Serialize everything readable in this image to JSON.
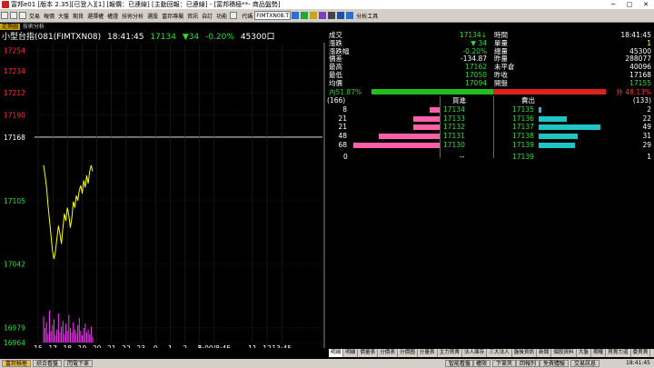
{
  "titlebar": {
    "title": "富邦e01 [版本 2.35][已登入][1] [報價：已連線] [主動回報：已連線] - [富邦積極**- 商品盤勢]",
    "minimize": "─",
    "maximize": "□",
    "close": "✕"
  },
  "menubar": {
    "items": [
      "交易",
      "報價",
      "大盤",
      "期貨",
      "選擇權",
      "權證",
      "技術分析",
      "選股",
      "富邦專屬",
      "資訊",
      "自訂",
      "功能"
    ],
    "search_label": "代碼",
    "search_value": "FIMTXN08.T",
    "analysis_tools": "分析工具"
  },
  "chart": {
    "tab_active": "走勢圖",
    "tab_other": "技術分析",
    "header": {
      "name": "小型台指(081(FIMTXN08)",
      "time": "18:41:45",
      "price": "17134",
      "change": "▼34",
      "pct": "-0.20%",
      "volume": "45300",
      "vol_mark": "口"
    },
    "y_ticks": [
      "17254",
      "17234",
      "17212",
      "17190",
      "17168",
      "17105",
      "17042",
      "16979",
      "16964"
    ],
    "x_ticks": [
      "15",
      "17",
      "18",
      "19",
      "20",
      "21",
      "22",
      "23",
      "0",
      "1",
      "2",
      "3",
      "5:00/8:45",
      "11",
      "12",
      "13:45"
    ]
  },
  "chart_data": {
    "type": "line",
    "series": [
      {
        "name": "",
        "values": [
          17140,
          17130,
          17118,
          17100,
          17085,
          17070,
          17055,
          17047,
          17055,
          17068,
          17080,
          17072,
          17062,
          17078,
          17092,
          17085,
          17098,
          17090,
          17078,
          17088,
          17104,
          17098,
          17110,
          17105,
          17115,
          17120,
          17112,
          17125,
          17118,
          17130,
          17122,
          17134,
          17140,
          17134
        ]
      }
    ],
    "ylim": [
      16964,
      17260
    ],
    "prev_close": 17168
  },
  "quote": {
    "rows": [
      {
        "l1": "成交",
        "v1": "17134↓",
        "c1": "#33dd33",
        "l2": "時間",
        "v2": "18:41:45",
        "c2": "#ffffff"
      },
      {
        "l1": "漲跌",
        "v1": "▼ 34",
        "c1": "#33dd33",
        "l2": "單量",
        "v2": "1",
        "c2": "#ffff33"
      },
      {
        "l1": "漲跌幅",
        "v1": "-0.20%",
        "c1": "#33dd33",
        "l2": "總量",
        "v2": "45300",
        "c2": "#ffffff"
      },
      {
        "l1": "價差",
        "v1": "-134.87",
        "c1": "#ffffff",
        "l2": "昨量",
        "v2": "288077",
        "c2": "#ffffff"
      },
      {
        "l1": "最高",
        "v1": "17162",
        "c1": "#33dd33",
        "l2": "未平倉",
        "v2": "40096",
        "c2": "#ffffff"
      },
      {
        "l1": "最低",
        "v1": "17050",
        "c1": "#33dd33",
        "l2": "昨收",
        "v2": "17168",
        "c2": "#ffffff"
      },
      {
        "l1": "均價",
        "v1": "17094",
        "c1": "#33dd33",
        "l2": "開盤",
        "v2": "17155",
        "c2": "#33dd33"
      }
    ],
    "ratio_left_label": "內51.87%",
    "ratio_right_label": "外 48.13%",
    "ratio_left": 0.5187,
    "ratio_right": 0.4813
  },
  "depth": {
    "header": {
      "bid_total": "(166)",
      "bid_label": "買進",
      "ask_label": "賣出",
      "ask_total": "(133)"
    },
    "rows": [
      {
        "bq": "8",
        "bp": "17134",
        "sp": "17135",
        "sq": "2",
        "bw": 0.12,
        "sw": 0.04
      },
      {
        "bq": "21",
        "bp": "17133",
        "sp": "17136",
        "sq": "22",
        "bw": 0.3,
        "sw": 0.45
      },
      {
        "bq": "21",
        "bp": "17132",
        "sp": "17137",
        "sq": "49",
        "bw": 0.3,
        "sw": 1.0
      },
      {
        "bq": "48",
        "bp": "17131",
        "sp": "17138",
        "sq": "31",
        "bw": 0.7,
        "sw": 0.63
      },
      {
        "bq": "68",
        "bp": "17130",
        "sp": "17139",
        "sq": "29",
        "bw": 1.0,
        "sw": 0.59
      }
    ],
    "footer": {
      "left": "0",
      "mid": "--",
      "price": "17139",
      "right": "1"
    }
  },
  "bottom_tabs": [
    "明細",
    "明細",
    "價量表",
    "分價表",
    "分價圖",
    "分量表",
    "主力買賣",
    "法人庫存",
    "三大法人",
    "盤後資訊",
    "新聞",
    "個股資料",
    "大盤",
    "期權",
    "買賣力道",
    "委買賣"
  ],
  "statusbar": {
    "btn1": "富邦積極",
    "btn2": "綜合看盤",
    "btn3": "閃電下單",
    "mid_items": [
      "智能看盤",
      "權限",
      "下單夾",
      "回報列",
      "免費體驗"
    ],
    "right_btn": "交易訊息",
    "clock": "18:41:45"
  },
  "colors": {
    "up": "#ff3333",
    "down": "#33dd33",
    "line": "#ffff00",
    "volume": "#ff33ff",
    "prev_close_line": "#ffffff"
  }
}
